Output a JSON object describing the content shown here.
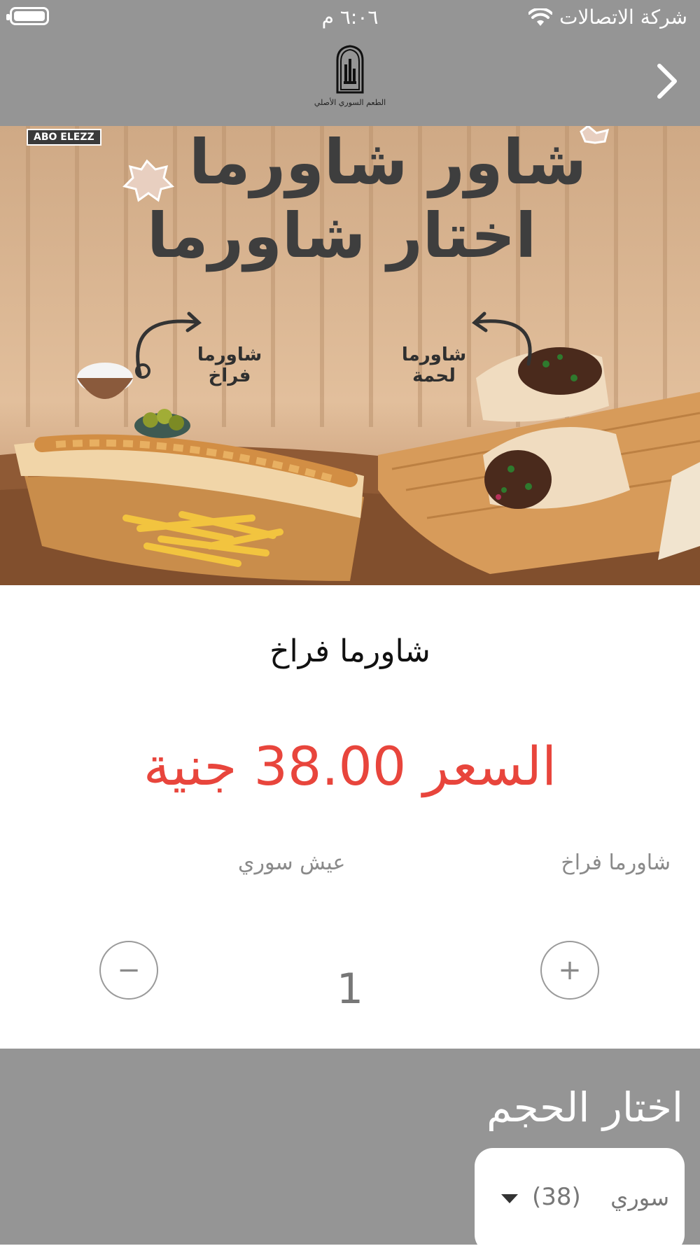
{
  "status_bar": {
    "carrier": "شركة الاتصالات",
    "time": "٦:٠٦ م"
  },
  "header": {
    "logo_caption": "الطعم السوري الأصلي",
    "logo_mark": "ABO ELEZZ"
  },
  "hero": {
    "brand_tag": "ABO ELEZZ",
    "headline_line1": "شاور شاورما",
    "headline_line2": "اختار شاورما",
    "label_chicken_1": "شاورما",
    "label_chicken_2": "فراخ",
    "label_meat_1": "شاورما",
    "label_meat_2": "لحمة"
  },
  "product": {
    "title": "شاورما فراخ",
    "price": "السعر 38.00 جنية"
  },
  "attributes": {
    "name": "شاورما فراخ",
    "bread": "عيش سوري"
  },
  "quantity": {
    "value": "1",
    "plus": "+",
    "minus": "−"
  },
  "size": {
    "title": "اختار الحجم",
    "selected_name": "سوري",
    "selected_price": "(38)"
  },
  "colors": {
    "bar": "#959595",
    "price": "#e8453c"
  }
}
